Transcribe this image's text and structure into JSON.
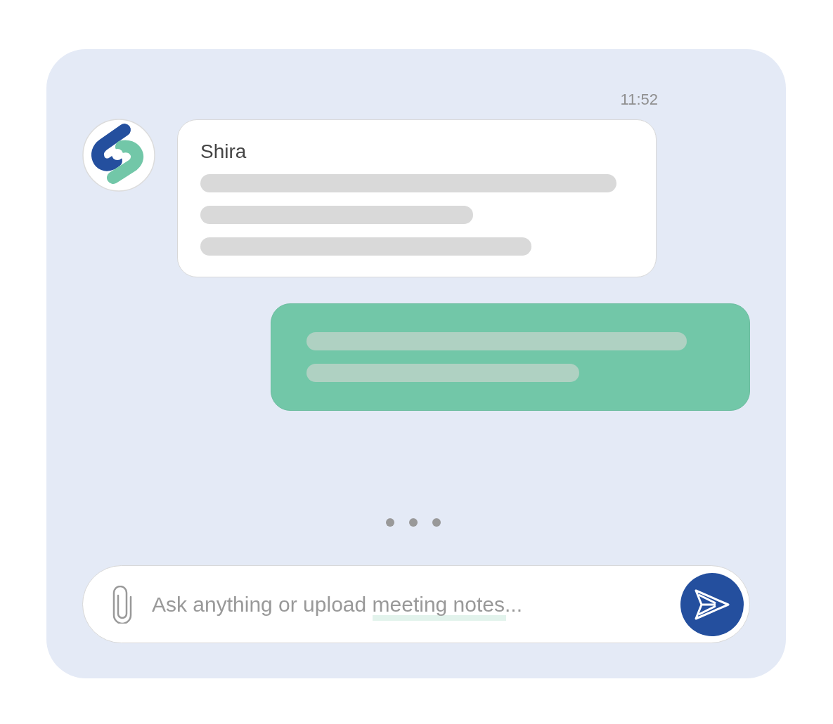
{
  "chat": {
    "timestamp": "11:52",
    "messages": [
      {
        "kind": "incoming",
        "sender": "Shira"
      },
      {
        "kind": "outgoing"
      }
    ],
    "typing_indicator": true,
    "composer": {
      "placeholder": "Ask anything or upload meeting notes..."
    }
  }
}
